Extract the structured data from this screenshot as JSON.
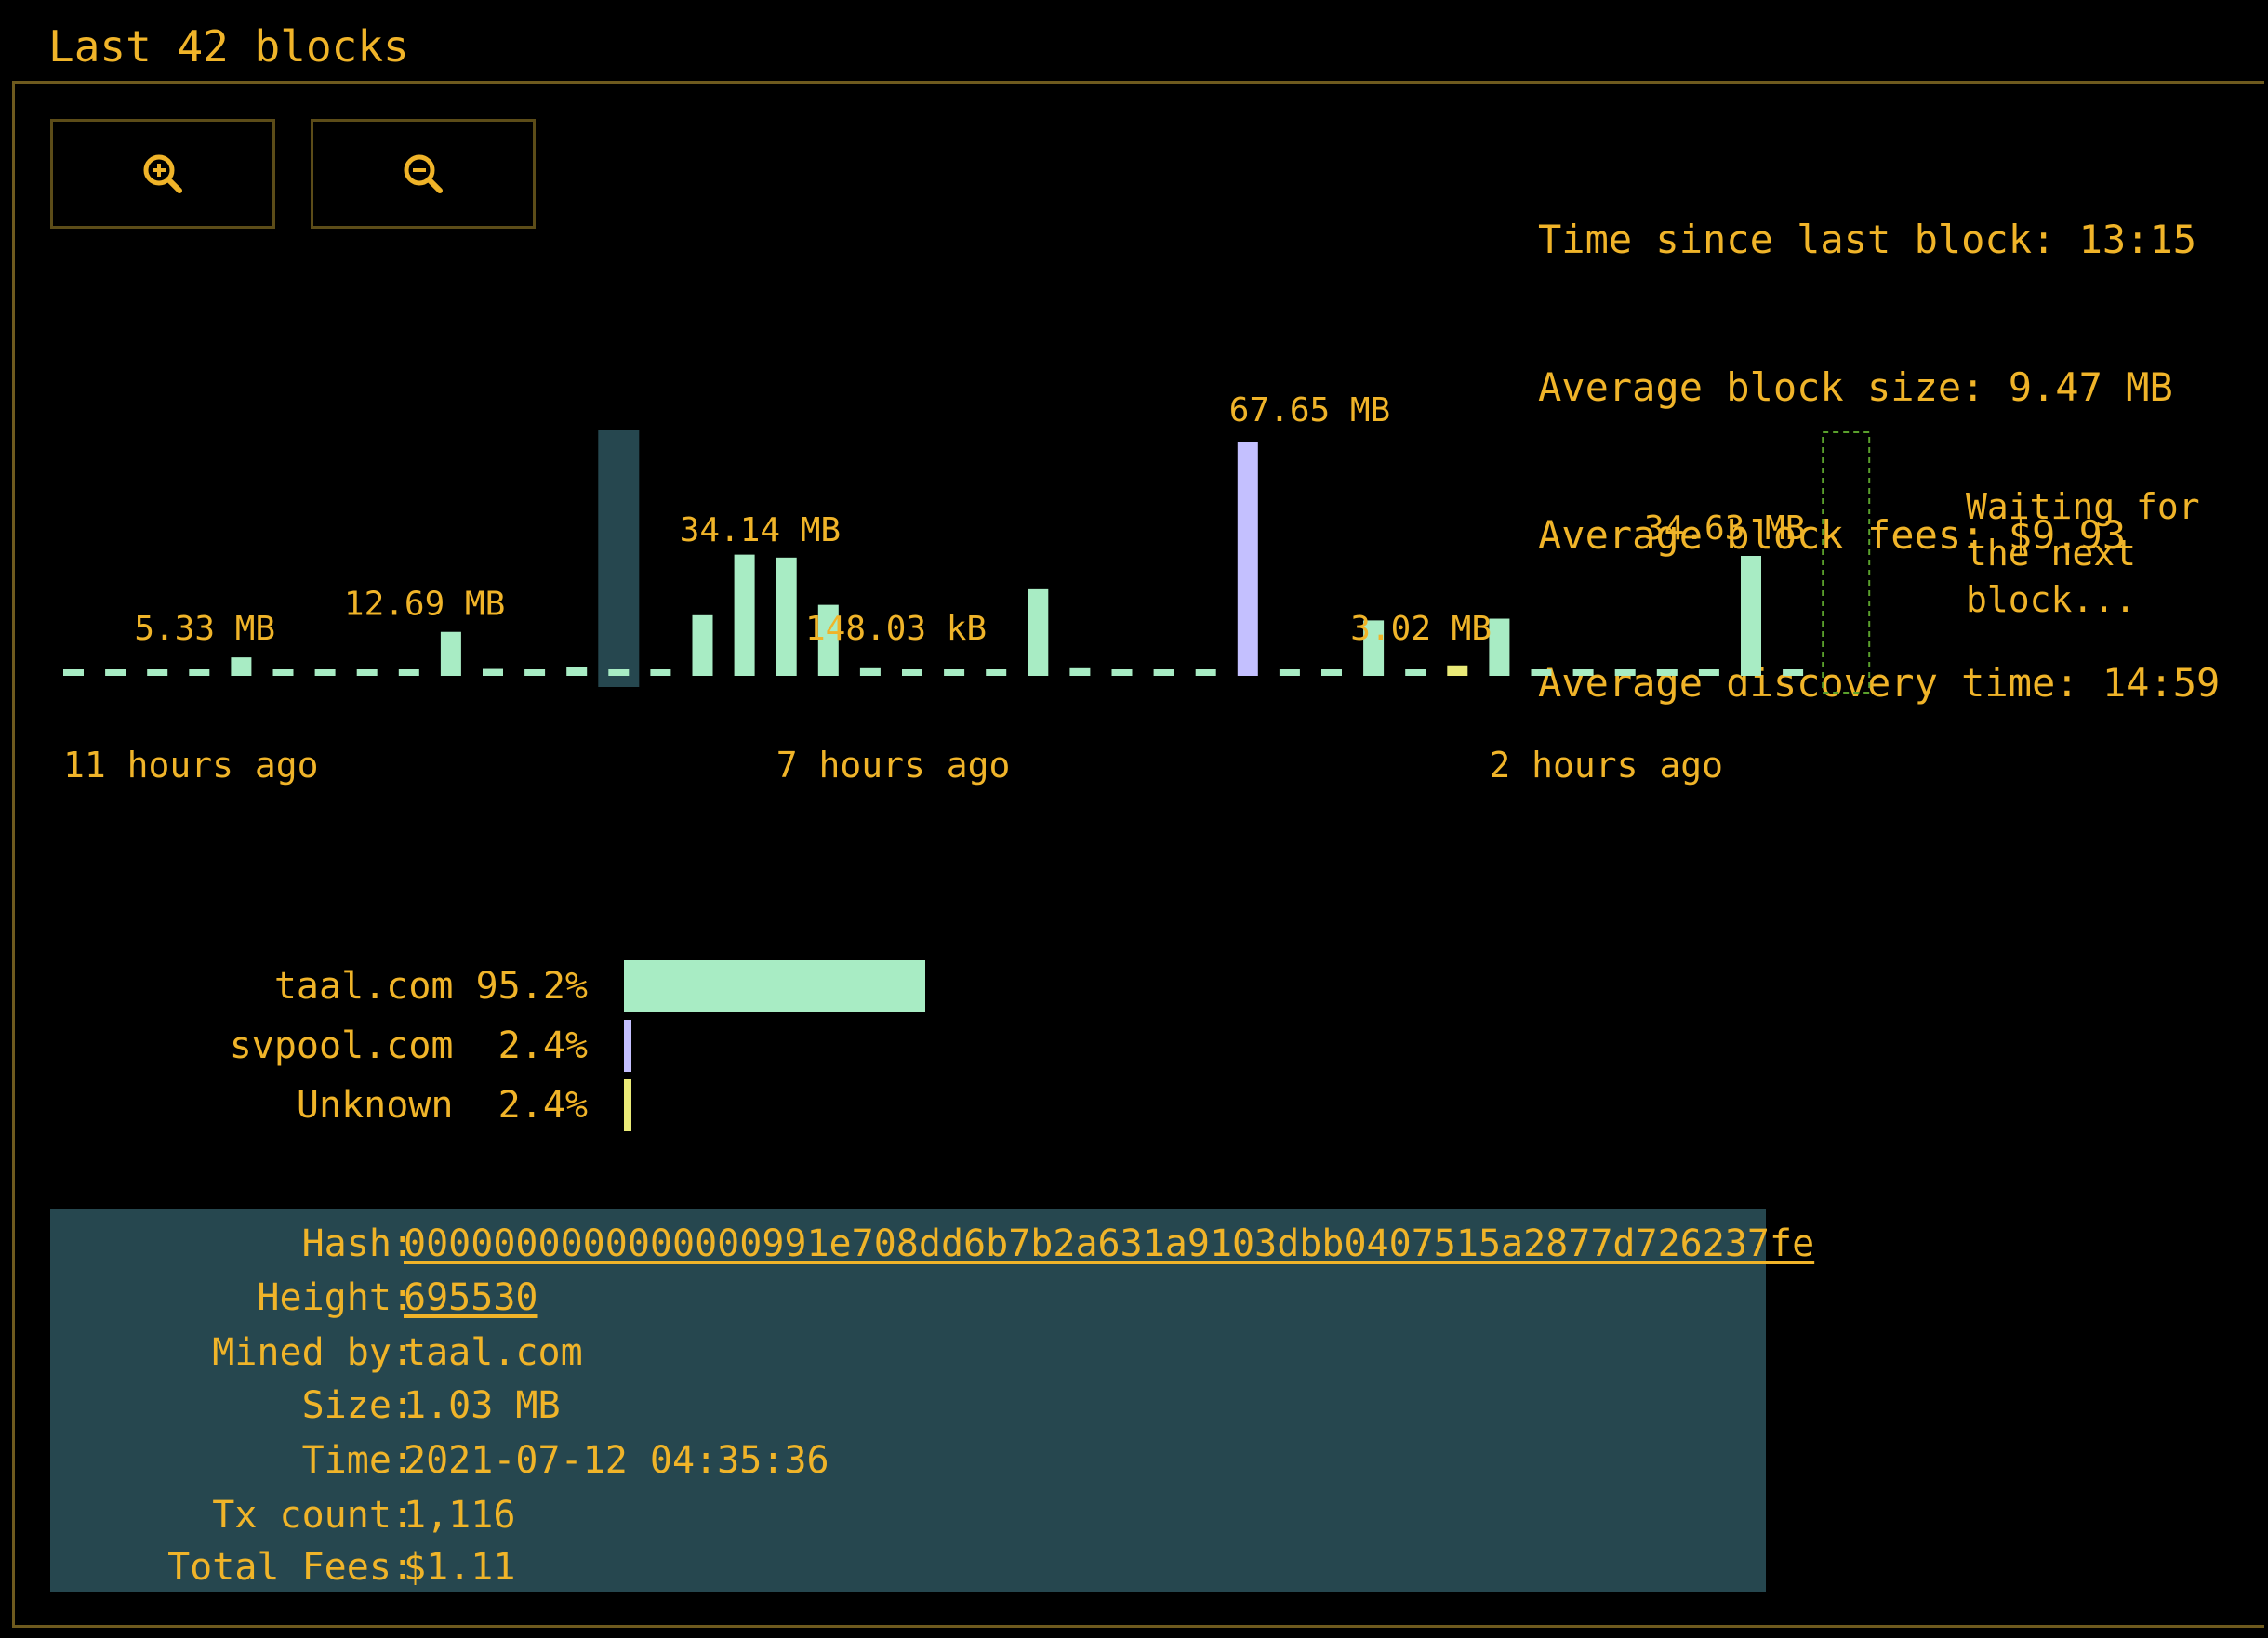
{
  "panel": {
    "title": "Last 42 blocks"
  },
  "toolbar": {
    "zoom_in_icon": "zoom-in-icon",
    "zoom_out_icon": "zoom-out-icon"
  },
  "stats": [
    {
      "label": "Time since last block:",
      "value": "13:15"
    },
    {
      "label": "Average block size:",
      "value": "9.47 MB"
    },
    {
      "label": "Average block fees:",
      "value": "$9.93"
    },
    {
      "label": "Average discovery time:",
      "value": "14:59"
    }
  ],
  "waiting_text": "Waiting for the next block...",
  "colors": {
    "accent": "#f0b429",
    "taal": "#a8ecc4",
    "svpool": "#c4c0ff",
    "unknown": "#eaea78",
    "selected": "#26474f",
    "pending_border": "#5aa02c"
  },
  "chart_data": {
    "type": "bar",
    "title": "",
    "xlabel": "",
    "ylabel": "",
    "unit": "MB",
    "selected_index": 13,
    "ymax": 67.65,
    "bars": [
      {
        "size": 0.15,
        "miner": "taal"
      },
      {
        "size": 1.1,
        "miner": "taal"
      },
      {
        "size": 0.15,
        "miner": "taal"
      },
      {
        "size": 0.5,
        "miner": "taal"
      },
      {
        "size": 5.33,
        "miner": "taal",
        "label": "5.33 MB"
      },
      {
        "size": 0.15,
        "miner": "taal"
      },
      {
        "size": 0.15,
        "miner": "taal"
      },
      {
        "size": 0.15,
        "miner": "taal"
      },
      {
        "size": 0.15,
        "miner": "taal"
      },
      {
        "size": 12.69,
        "miner": "taal",
        "label": "12.69 MB"
      },
      {
        "size": 2.0,
        "miner": "taal"
      },
      {
        "size": 1.2,
        "miner": "taal"
      },
      {
        "size": 2.5,
        "miner": "taal"
      },
      {
        "size": 1.03,
        "miner": "taal"
      },
      {
        "size": 1.8,
        "miner": "taal"
      },
      {
        "size": 17.5,
        "miner": "taal"
      },
      {
        "size": 35.0,
        "miner": "taal"
      },
      {
        "size": 34.14,
        "miner": "taal",
        "label": "34.14 MB"
      },
      {
        "size": 20.5,
        "miner": "taal"
      },
      {
        "size": 2.2,
        "miner": "taal"
      },
      {
        "size": 0.148,
        "miner": "taal",
        "label": "148.03 kB"
      },
      {
        "size": 0.15,
        "miner": "taal"
      },
      {
        "size": 0.15,
        "miner": "taal"
      },
      {
        "size": 25.0,
        "miner": "taal"
      },
      {
        "size": 2.2,
        "miner": "taal"
      },
      {
        "size": 1.5,
        "miner": "taal"
      },
      {
        "size": 0.15,
        "miner": "taal"
      },
      {
        "size": 0.15,
        "miner": "taal"
      },
      {
        "size": 67.65,
        "miner": "svpool",
        "label": "67.65 MB"
      },
      {
        "size": 0.15,
        "miner": "taal"
      },
      {
        "size": 0.15,
        "miner": "taal"
      },
      {
        "size": 16.0,
        "miner": "taal"
      },
      {
        "size": 0.15,
        "miner": "taal"
      },
      {
        "size": 3.02,
        "miner": "unknown",
        "label": "3.02 MB"
      },
      {
        "size": 16.5,
        "miner": "taal"
      },
      {
        "size": 0.15,
        "miner": "taal"
      },
      {
        "size": 0.15,
        "miner": "taal"
      },
      {
        "size": 0.15,
        "miner": "taal"
      },
      {
        "size": 1.4,
        "miner": "taal"
      },
      {
        "size": 0.15,
        "miner": "taal"
      },
      {
        "size": 34.63,
        "miner": "taal",
        "label": "34.63 MB"
      },
      {
        "size": 0.15,
        "miner": "taal"
      }
    ],
    "time_labels": [
      {
        "text": "11 hours ago",
        "at_bar": 0
      },
      {
        "text": "7 hours ago",
        "at_bar": 17
      },
      {
        "text": "2 hours ago",
        "at_bar": 34
      }
    ]
  },
  "miners": [
    {
      "name": "taal.com",
      "pct_label": "95.2%",
      "pct": 95.2,
      "key": "taal"
    },
    {
      "name": "svpool.com",
      "pct_label": "2.4%",
      "pct": 2.4,
      "key": "svpool"
    },
    {
      "name": "Unknown",
      "pct_label": "2.4%",
      "pct": 2.4,
      "key": "unknown"
    }
  ],
  "details": {
    "hash_label": "Hash:",
    "hash": "0000000000000000991e708dd6b7b2a631a9103dbb0407515a2877d726237fe",
    "height_label": "Height:",
    "height": "695530",
    "mined_by_label": "Mined by:",
    "mined_by": "taal.com",
    "size_label": "Size:",
    "size": "1.03 MB",
    "time_label": "Time:",
    "time": "2021-07-12 04:35:36",
    "tx_count_label": "Tx count:",
    "tx_count": "1,116",
    "total_fees_label": "Total Fees:",
    "total_fees": "$1.11"
  }
}
